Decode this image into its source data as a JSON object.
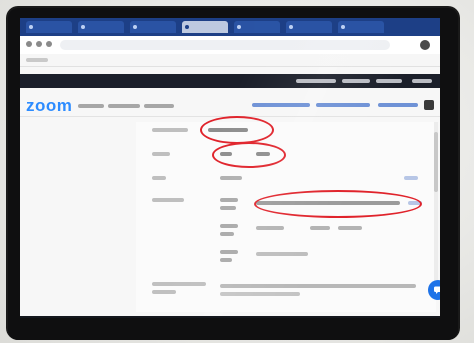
{
  "zoom": {
    "logo_text": "zoom"
  },
  "annotations": {
    "ring_color": "#e0232b",
    "count": 3
  },
  "colors": {
    "zoom_blue": "#2d8cff",
    "fab_blue": "#1e73e8",
    "taskbar": "#14171d"
  },
  "icons": {
    "fab": "chat-bubble-icon",
    "start": "windows-start-icon",
    "taskbar_search": "search-icon"
  }
}
